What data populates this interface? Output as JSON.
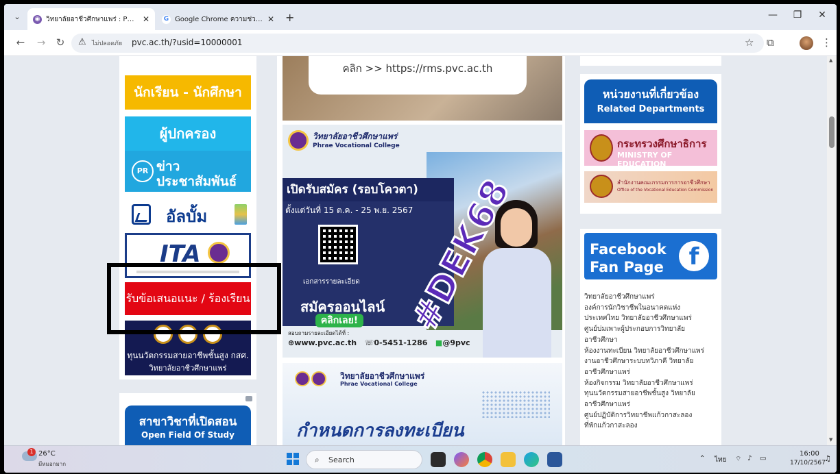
{
  "browser": {
    "tabs": [
      {
        "title": "วิทยาลัยอาชีวศึกษาแพร่ : PVC : วิทย",
        "active": true
      },
      {
        "title": "Google Chrome ความช่วยเหลือ",
        "active": false
      }
    ],
    "not_secure_label": "ไม่ปลอดภัย",
    "url": "pvc.ac.th/?usid=10000001"
  },
  "left": {
    "students": "นักเรียน - นักศึกษา",
    "parents": "ผู้ปกครอง",
    "news_badge": "PR",
    "news_l1": "ข่าว",
    "news_l2": "ประชาสัมพันธ์",
    "album": "อัลบั้ม",
    "ita_logo": "ITA",
    "complaint": "รับข้อเสนอแนะ / ร้องเรียน",
    "innov_l1": "ทุนนวัตกรรมสายอาชีพชั้นสูง กสศ.",
    "innov_l2": "วิทยาลัยอาชีวศึกษาแพร่",
    "field_l1": "สาขาวิชาที่เปิดสอน",
    "field_l2": "Open Field Of Study"
  },
  "center": {
    "rms": "คลิก >> https://rms.pvc.ac.th",
    "college_th": "วิทยาลัยอาชีวศึกษาแพร่",
    "college_en": "Phrae Vocational College",
    "headline": "เปิดรับสมัคร (รอบโควตา)",
    "dates": "ตั้งแต่วันที่ 15 ต.ค. - 25 พ.ย. 2567",
    "docs": "เอกสารรายละเอียด",
    "apply": "สมัครออนไลน์",
    "click": "คลิกเลย!",
    "dek": "#DEK68",
    "contact_label": "สอบถามรายละเอียดได้ที่ :",
    "contact_web": "www.pvc.ac.th",
    "contact_phone": "0-5451-1286",
    "contact_line": "@9pvc",
    "p2_th": "วิทยาลัยอาชีวศึกษาแพร่",
    "p2_en": "Phrae Vocational College",
    "p2_title": "กำหนดการลงทะเบียน"
  },
  "right": {
    "rel_l1": "หน่วยงานที่เกี่ยวข้อง",
    "rel_l2": "Related Departments",
    "moe_th": "กระทรวงศึกษาธิการ",
    "moe_en": "MINISTRY OF EDUCATION",
    "ovec_th": "สำนักงานคณะกรรมการการอาชีวศึกษา",
    "ovec_en": "Office of the Vocational Education Commission",
    "fb_l1": "Facebook",
    "fb_l2": "Fan Page",
    "fb_icon": "f",
    "fb_links": [
      "วิทยาลัยอาชีวศึกษาแพร่",
      "องค์การนักวิชาชีพในอนาคตแห่ง",
      "ประเทศไทย วิทยาลัยอาชีวศึกษาแพร่",
      "ศูนย์บ่มเพาะผู้ประกอบการวิทยาลัย",
      "อาชีวศึกษา",
      "ห้องงานทะเบียน วิทยาลัยอาชีวศึกษาแพร่",
      "งานอาชีวศึกษาระบบทวิภาคี วิทยาลัย",
      "อาชีวศึกษาแพร่",
      "ห้องกิจกรรม วิทยาลัยอาชีวศึกษาแพร่",
      "ทุนนวัตกรรมสายอาชีพชั้นสูง วิทยาลัย",
      "อาชีวศึกษาแพร่",
      "ศูนย์ปฏิบัติการวิทยาชีพแก้วกาสะลอง",
      "ที่พักแก้วกาสะลอง"
    ]
  },
  "taskbar": {
    "weather_badge": "1",
    "temp": "26°C",
    "cond": "มีหมอกมาก",
    "search": "Search",
    "lang": "ไทย",
    "time": "16:00",
    "date": "17/10/2567"
  }
}
